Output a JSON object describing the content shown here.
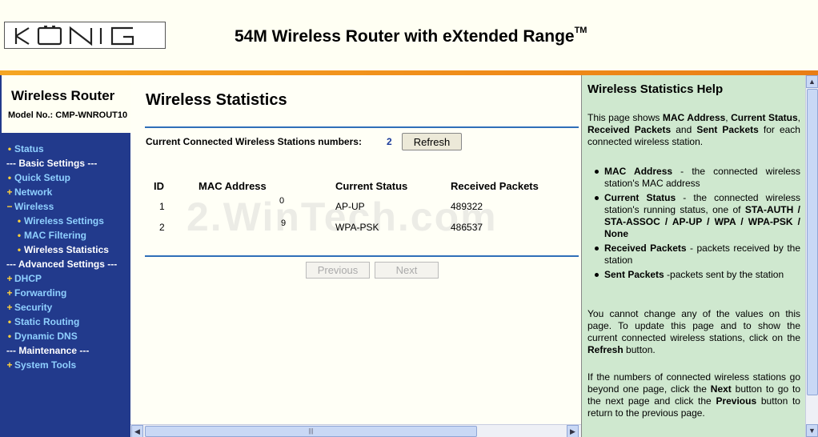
{
  "header": {
    "logo_text": "KÖNIG",
    "product_title": "54M Wireless Router with eXtended Range",
    "trademark": "TM"
  },
  "sidebar": {
    "title": "Wireless Router",
    "model": "Model No.: CMP-WNROUT10",
    "items": [
      {
        "label": "Status",
        "prefix": "•"
      },
      {
        "label": "--- Basic Settings ---",
        "prefix": ""
      },
      {
        "label": "Quick Setup",
        "prefix": "•"
      },
      {
        "label": "Network",
        "prefix": "+"
      },
      {
        "label": "Wireless",
        "prefix": "−"
      },
      {
        "label": "Wireless Settings",
        "prefix": "•"
      },
      {
        "label": "MAC Filtering",
        "prefix": "•"
      },
      {
        "label": "Wireless Statistics",
        "prefix": "•"
      },
      {
        "label": "--- Advanced Settings ---",
        "prefix": ""
      },
      {
        "label": "DHCP",
        "prefix": "+"
      },
      {
        "label": "Forwarding",
        "prefix": "+"
      },
      {
        "label": "Security",
        "prefix": "+"
      },
      {
        "label": "Static Routing",
        "prefix": "•"
      },
      {
        "label": "Dynamic DNS",
        "prefix": "•"
      },
      {
        "label": "--- Maintenance ---",
        "prefix": ""
      },
      {
        "label": "System Tools",
        "prefix": "+"
      }
    ]
  },
  "main": {
    "title": "Wireless Statistics",
    "stations_label": "Current Connected Wireless Stations numbers:",
    "stations_count": "2",
    "refresh_label": "Refresh",
    "columns": [
      "ID",
      "MAC Address",
      "Current Status",
      "Received Packets"
    ],
    "rows": [
      {
        "id": "1",
        "mac": "0",
        "status": "AP-UP",
        "received": "489322"
      },
      {
        "id": "2",
        "mac": "9",
        "status": "WPA-PSK",
        "received": "486537"
      }
    ],
    "previous_label": "Previous",
    "next_label": "Next",
    "watermark": "2.WinTech.com"
  },
  "help": {
    "title": "Wireless Statistics Help",
    "intro_parts": [
      "This page shows ",
      "MAC Address",
      ", ",
      "Current Status",
      ", ",
      "Received Packets",
      " and ",
      "Sent Packets",
      " for each connected wireless station."
    ],
    "bullets": [
      {
        "term": "MAC Address",
        "text": " - the connected wireless station's MAC address"
      },
      {
        "term": "Current Status",
        "text": " - the connected wireless station's running status, one of ",
        "extra": "STA-AUTH / STA-ASSOC / AP-UP / WPA / WPA-PSK / None"
      },
      {
        "term": "Received Packets",
        "text": " - packets received by the station"
      },
      {
        "term": "Sent Packets",
        "text": " -packets sent by the station"
      }
    ],
    "para2_parts": [
      "You cannot change any of the values on this page. To update this page and to show the current connected wireless stations, click on the ",
      "Refresh",
      " button."
    ],
    "para3_parts": [
      "If the numbers of connected wireless stations go beyond one page, click the ",
      "Next",
      " button to go to the next page and click the ",
      "Previous",
      " button to return to the previous page."
    ]
  },
  "colors": {
    "nav_bg": "#223a8c",
    "nav_link": "#8fd0ff",
    "accent_orange": "#f08c1a",
    "help_bg": "#cfe8cf",
    "rule_blue": "#2f6fb8"
  }
}
